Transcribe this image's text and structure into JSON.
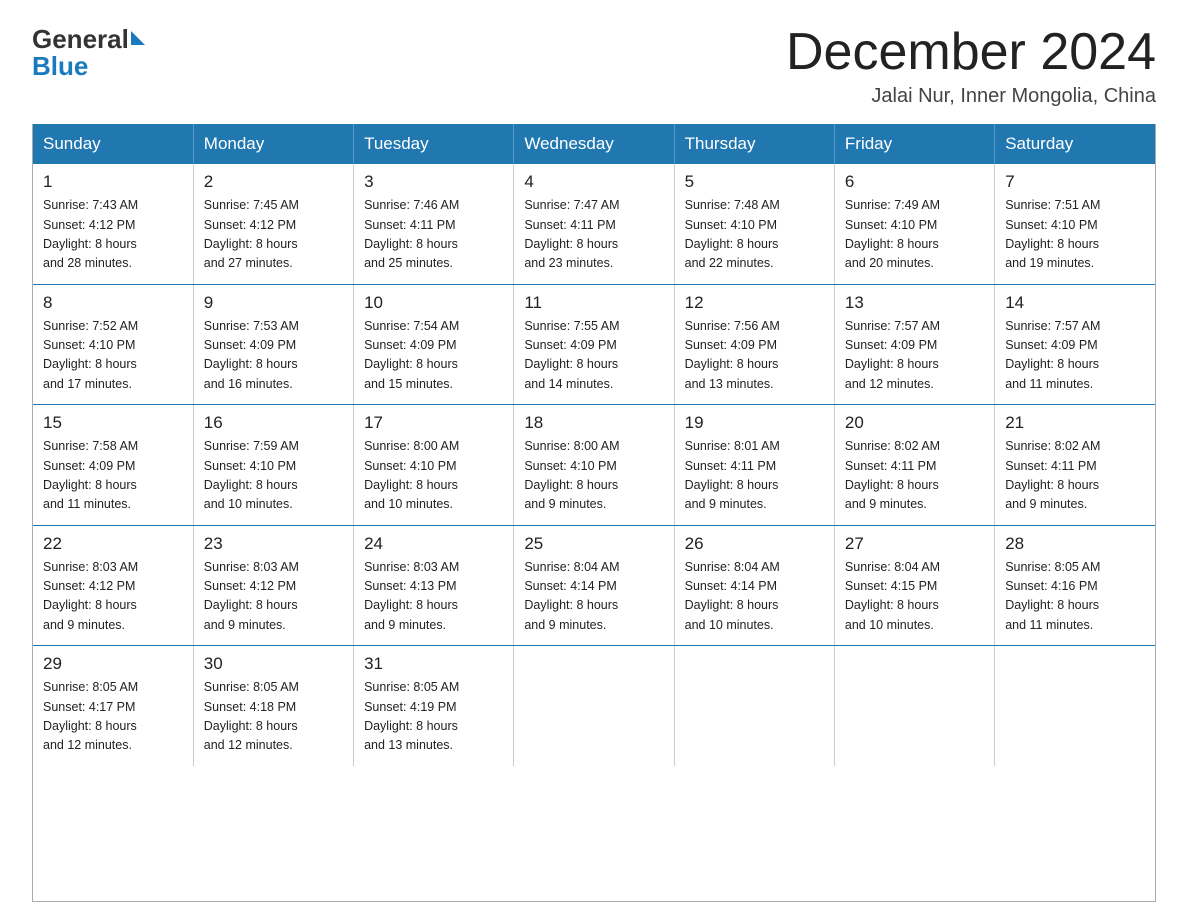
{
  "logo": {
    "general": "General",
    "blue": "Blue"
  },
  "header": {
    "title": "December 2024",
    "subtitle": "Jalai Nur, Inner Mongolia, China"
  },
  "weekdays": [
    "Sunday",
    "Monday",
    "Tuesday",
    "Wednesday",
    "Thursday",
    "Friday",
    "Saturday"
  ],
  "weeks": [
    [
      {
        "day": "1",
        "sunrise": "7:43 AM",
        "sunset": "4:12 PM",
        "daylight": "8 hours and 28 minutes."
      },
      {
        "day": "2",
        "sunrise": "7:45 AM",
        "sunset": "4:12 PM",
        "daylight": "8 hours and 27 minutes."
      },
      {
        "day": "3",
        "sunrise": "7:46 AM",
        "sunset": "4:11 PM",
        "daylight": "8 hours and 25 minutes."
      },
      {
        "day": "4",
        "sunrise": "7:47 AM",
        "sunset": "4:11 PM",
        "daylight": "8 hours and 23 minutes."
      },
      {
        "day": "5",
        "sunrise": "7:48 AM",
        "sunset": "4:10 PM",
        "daylight": "8 hours and 22 minutes."
      },
      {
        "day": "6",
        "sunrise": "7:49 AM",
        "sunset": "4:10 PM",
        "daylight": "8 hours and 20 minutes."
      },
      {
        "day": "7",
        "sunrise": "7:51 AM",
        "sunset": "4:10 PM",
        "daylight": "8 hours and 19 minutes."
      }
    ],
    [
      {
        "day": "8",
        "sunrise": "7:52 AM",
        "sunset": "4:10 PM",
        "daylight": "8 hours and 17 minutes."
      },
      {
        "day": "9",
        "sunrise": "7:53 AM",
        "sunset": "4:09 PM",
        "daylight": "8 hours and 16 minutes."
      },
      {
        "day": "10",
        "sunrise": "7:54 AM",
        "sunset": "4:09 PM",
        "daylight": "8 hours and 15 minutes."
      },
      {
        "day": "11",
        "sunrise": "7:55 AM",
        "sunset": "4:09 PM",
        "daylight": "8 hours and 14 minutes."
      },
      {
        "day": "12",
        "sunrise": "7:56 AM",
        "sunset": "4:09 PM",
        "daylight": "8 hours and 13 minutes."
      },
      {
        "day": "13",
        "sunrise": "7:57 AM",
        "sunset": "4:09 PM",
        "daylight": "8 hours and 12 minutes."
      },
      {
        "day": "14",
        "sunrise": "7:57 AM",
        "sunset": "4:09 PM",
        "daylight": "8 hours and 11 minutes."
      }
    ],
    [
      {
        "day": "15",
        "sunrise": "7:58 AM",
        "sunset": "4:09 PM",
        "daylight": "8 hours and 11 minutes."
      },
      {
        "day": "16",
        "sunrise": "7:59 AM",
        "sunset": "4:10 PM",
        "daylight": "8 hours and 10 minutes."
      },
      {
        "day": "17",
        "sunrise": "8:00 AM",
        "sunset": "4:10 PM",
        "daylight": "8 hours and 10 minutes."
      },
      {
        "day": "18",
        "sunrise": "8:00 AM",
        "sunset": "4:10 PM",
        "daylight": "8 hours and 9 minutes."
      },
      {
        "day": "19",
        "sunrise": "8:01 AM",
        "sunset": "4:11 PM",
        "daylight": "8 hours and 9 minutes."
      },
      {
        "day": "20",
        "sunrise": "8:02 AM",
        "sunset": "4:11 PM",
        "daylight": "8 hours and 9 minutes."
      },
      {
        "day": "21",
        "sunrise": "8:02 AM",
        "sunset": "4:11 PM",
        "daylight": "8 hours and 9 minutes."
      }
    ],
    [
      {
        "day": "22",
        "sunrise": "8:03 AM",
        "sunset": "4:12 PM",
        "daylight": "8 hours and 9 minutes."
      },
      {
        "day": "23",
        "sunrise": "8:03 AM",
        "sunset": "4:12 PM",
        "daylight": "8 hours and 9 minutes."
      },
      {
        "day": "24",
        "sunrise": "8:03 AM",
        "sunset": "4:13 PM",
        "daylight": "8 hours and 9 minutes."
      },
      {
        "day": "25",
        "sunrise": "8:04 AM",
        "sunset": "4:14 PM",
        "daylight": "8 hours and 9 minutes."
      },
      {
        "day": "26",
        "sunrise": "8:04 AM",
        "sunset": "4:14 PM",
        "daylight": "8 hours and 10 minutes."
      },
      {
        "day": "27",
        "sunrise": "8:04 AM",
        "sunset": "4:15 PM",
        "daylight": "8 hours and 10 minutes."
      },
      {
        "day": "28",
        "sunrise": "8:05 AM",
        "sunset": "4:16 PM",
        "daylight": "8 hours and 11 minutes."
      }
    ],
    [
      {
        "day": "29",
        "sunrise": "8:05 AM",
        "sunset": "4:17 PM",
        "daylight": "8 hours and 12 minutes."
      },
      {
        "day": "30",
        "sunrise": "8:05 AM",
        "sunset": "4:18 PM",
        "daylight": "8 hours and 12 minutes."
      },
      {
        "day": "31",
        "sunrise": "8:05 AM",
        "sunset": "4:19 PM",
        "daylight": "8 hours and 13 minutes."
      },
      null,
      null,
      null,
      null
    ]
  ],
  "labels": {
    "sunrise": "Sunrise:",
    "sunset": "Sunset:",
    "daylight": "Daylight:"
  }
}
